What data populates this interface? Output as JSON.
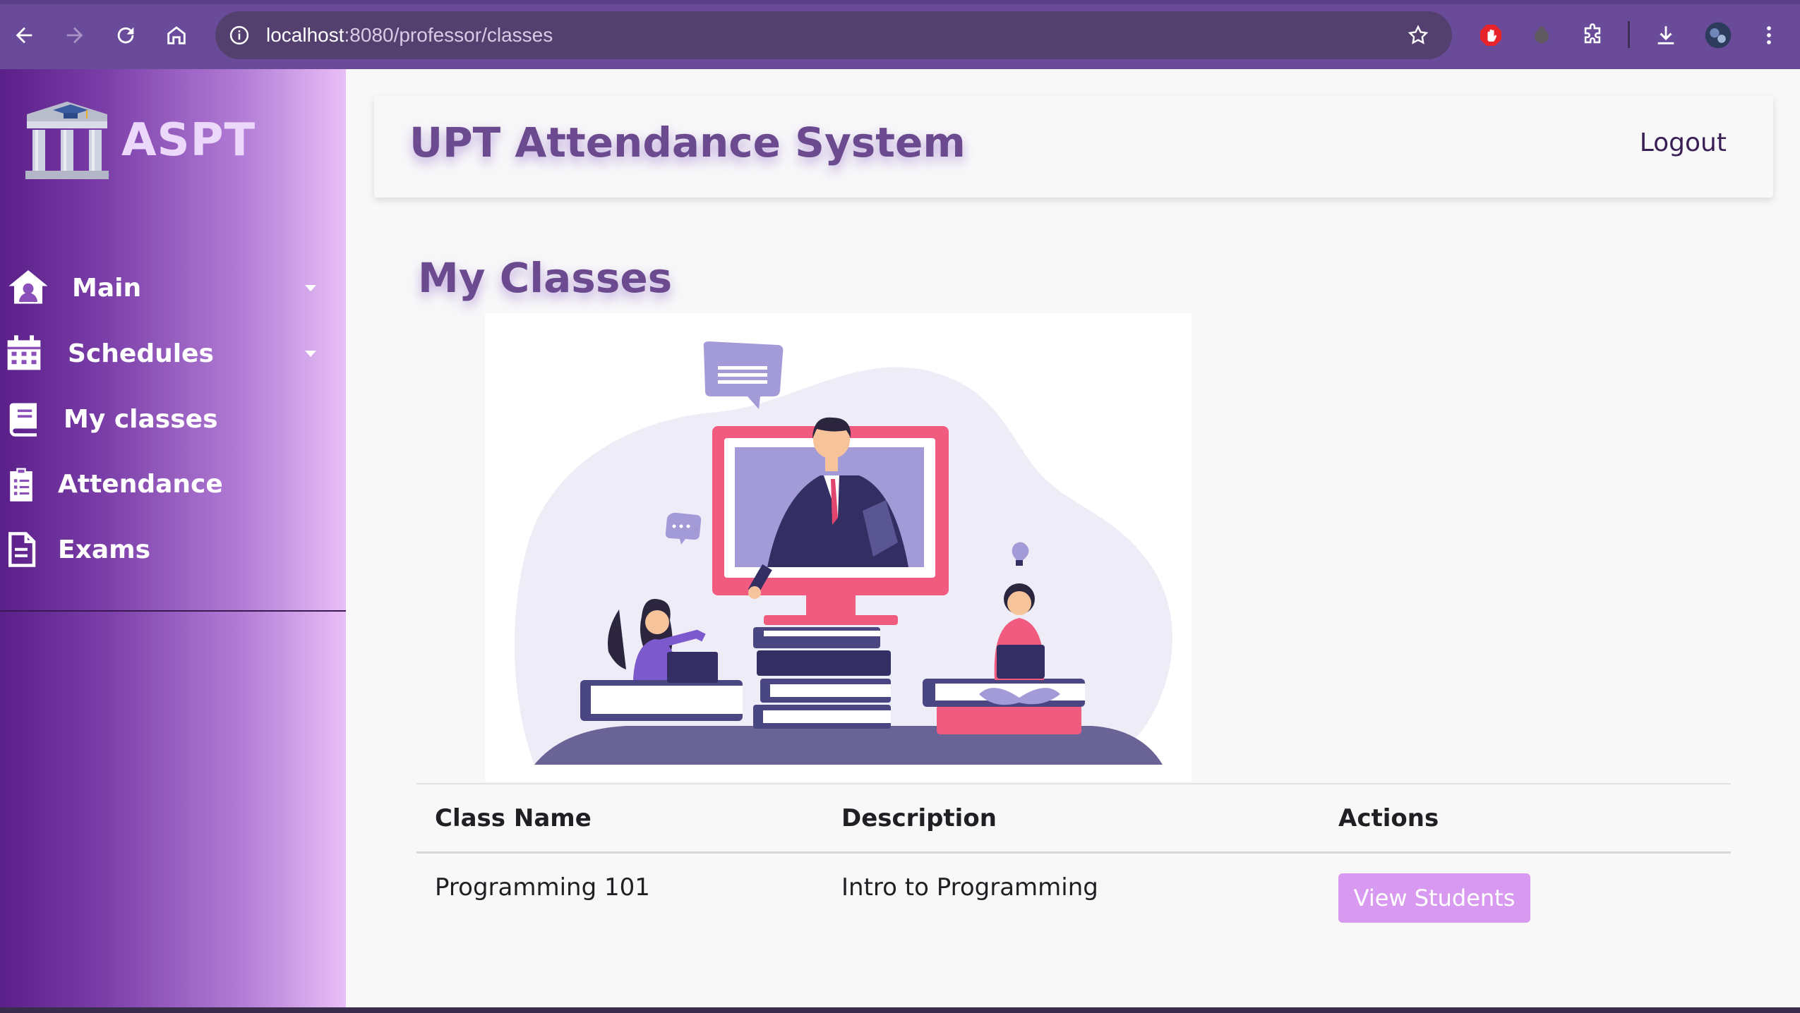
{
  "browser": {
    "url_host": "localhost",
    "url_path": ":8080/professor/classes"
  },
  "sidebar": {
    "brand": "ASPT",
    "items": [
      {
        "label": "Main",
        "icon": "home-user-icon",
        "has_caret": true
      },
      {
        "label": "Schedules",
        "icon": "calendar-icon",
        "has_caret": true
      },
      {
        "label": "My classes",
        "icon": "book-icon",
        "has_caret": false
      },
      {
        "label": "Attendance",
        "icon": "clipboard-list-icon",
        "has_caret": false
      },
      {
        "label": "Exams",
        "icon": "document-icon",
        "has_caret": false
      }
    ]
  },
  "header": {
    "title": "UPT Attendance System",
    "logout": "Logout"
  },
  "main": {
    "title": "My Classes",
    "table": {
      "headers": [
        "Class Name",
        "Description",
        "Actions"
      ],
      "rows": [
        {
          "class_name": "Programming 101",
          "description": "Intro to Programming",
          "action": "View Students"
        }
      ]
    }
  },
  "colors": {
    "sidebar_dark": "#5a1f89",
    "sidebar_light": "#e9bff7",
    "title_purple": "#6b4a8f",
    "button": "#d89af0"
  }
}
